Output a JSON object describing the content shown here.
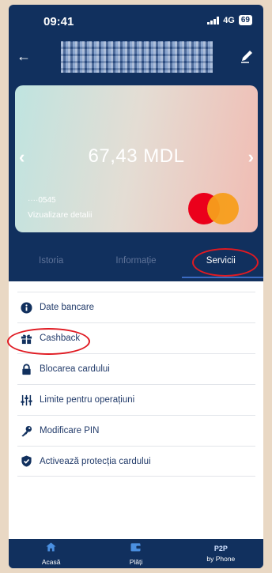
{
  "status_bar": {
    "time": "09:41",
    "network": "4G",
    "battery": "69"
  },
  "card": {
    "balance": "67,43 MDL",
    "number_masked": "····0545",
    "details_link": "Vizualizare detalii",
    "brand": "mastercard"
  },
  "tabs": [
    {
      "label": "Istoria"
    },
    {
      "label": "Informație"
    },
    {
      "label": "Servicii",
      "active": true
    }
  ],
  "services": [
    {
      "label": "Date bancare",
      "icon": "info-icon"
    },
    {
      "label": "Cashback",
      "icon": "gift-icon"
    },
    {
      "label": "Blocarea cardului",
      "icon": "lock-icon"
    },
    {
      "label": "Limite pentru operațiuni",
      "icon": "sliders-icon"
    },
    {
      "label": "Modificare PIN",
      "icon": "key-icon"
    },
    {
      "label": "Activează protecția cardului",
      "icon": "shield-check-icon"
    }
  ],
  "bottom_nav": [
    {
      "label": "Acasă",
      "icon": "home-icon"
    },
    {
      "label": "Plăți",
      "icon": "wallet-icon"
    },
    {
      "top": "P2P",
      "label": "by Phone"
    }
  ],
  "colors": {
    "background": "#11305e",
    "accent": "#3b6bc2",
    "highlight": "#e01a22",
    "text": "#223b6a"
  }
}
